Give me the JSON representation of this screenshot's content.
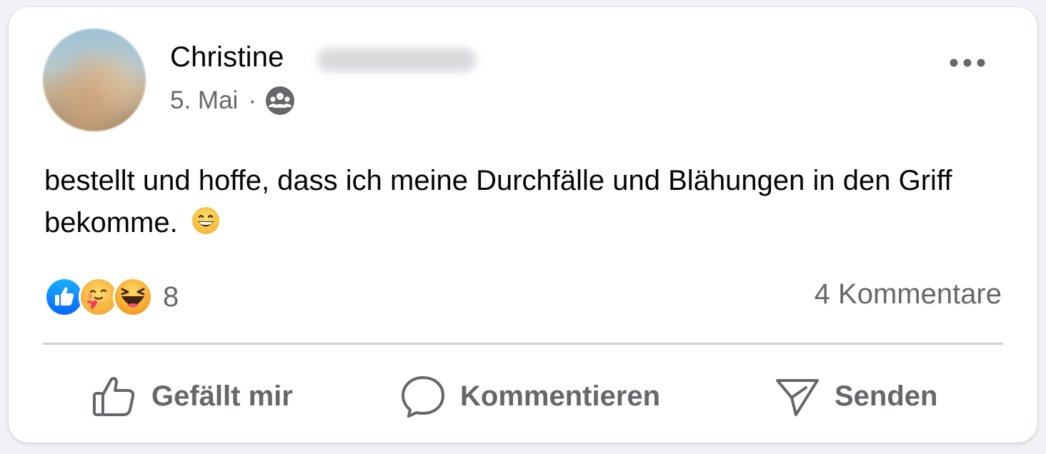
{
  "post": {
    "author_name": "Christine",
    "date": "5. Mai",
    "separator": "·",
    "audience_icon": "group-icon",
    "body_text": "bestellt und hoffe, dass ich meine Durchfälle und Blähungen in den Griff bekomme.",
    "body_emoji": "grinning-face-icon"
  },
  "reactions": {
    "types": [
      "like-icon",
      "care-icon",
      "haha-icon"
    ],
    "count": "8",
    "comments_label": "4 Kommentare"
  },
  "actions": {
    "like_label": "Gefällt mir",
    "comment_label": "Kommentieren",
    "share_label": "Senden"
  },
  "colors": {
    "like_blue": "#1877f2",
    "secondary_text": "#65676b",
    "primary_text": "#050505",
    "divider": "#ced0d4"
  }
}
